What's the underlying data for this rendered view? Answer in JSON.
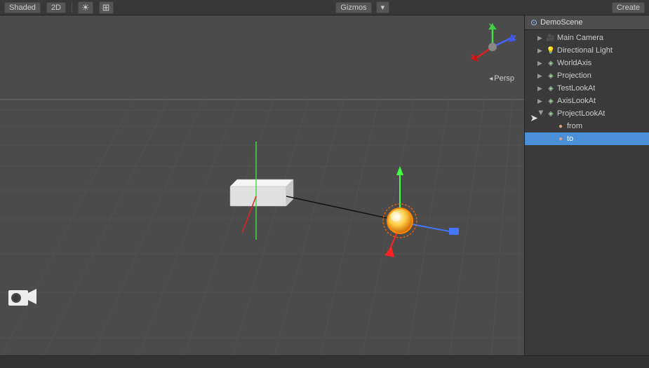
{
  "toolbar": {
    "left_buttons": [
      "Shaded",
      "2D",
      "gizmo1",
      "gizmo2"
    ],
    "center_buttons": [
      "Gizmos",
      "v"
    ],
    "right_buttons": []
  },
  "viewport": {
    "projection": "Persp",
    "camera_label": "◂Persp"
  },
  "hierarchy": {
    "title": "DemoScene",
    "items": [
      {
        "id": "main-camera",
        "label": "Main Camera",
        "indent": 1,
        "icon": "camera",
        "expanded": false,
        "selected": false
      },
      {
        "id": "directional-light",
        "label": "Directional Light",
        "indent": 1,
        "icon": "light",
        "expanded": false,
        "selected": false
      },
      {
        "id": "world-axis",
        "label": "WorldAxis",
        "indent": 1,
        "icon": "object",
        "expanded": false,
        "selected": false
      },
      {
        "id": "projection",
        "label": "Projection",
        "indent": 1,
        "icon": "object",
        "expanded": false,
        "selected": false
      },
      {
        "id": "test-look-at",
        "label": "TestLookAt",
        "indent": 1,
        "icon": "object",
        "expanded": false,
        "selected": false
      },
      {
        "id": "axis-look-at",
        "label": "AxisLookAt",
        "indent": 1,
        "icon": "object",
        "expanded": false,
        "selected": false
      },
      {
        "id": "project-look-at",
        "label": "ProjectLookAt",
        "indent": 1,
        "icon": "object",
        "expanded": true,
        "selected": false
      },
      {
        "id": "from",
        "label": "from",
        "indent": 2,
        "icon": "sphere",
        "expanded": false,
        "selected": false
      },
      {
        "id": "to",
        "label": "to",
        "indent": 2,
        "icon": "sphere",
        "expanded": false,
        "selected": true
      }
    ]
  },
  "status": ""
}
